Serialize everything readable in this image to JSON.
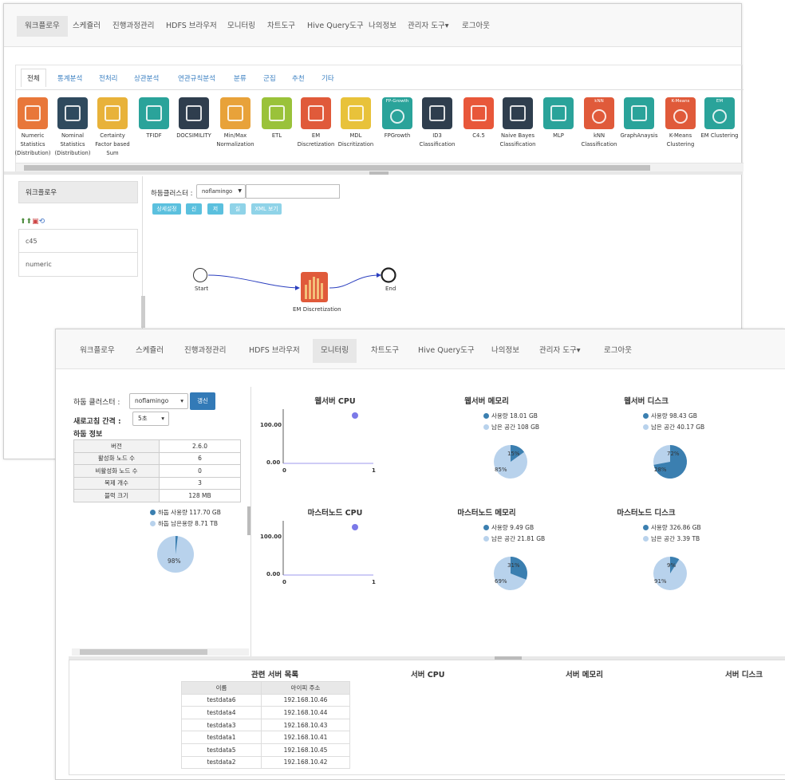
{
  "back_window": {
    "nav": [
      "워크플로우",
      "스케쥴러",
      "진행과정관리",
      "HDFS 브라우저",
      "모니터링",
      "차트도구",
      "Hive Query도구",
      "나의정보",
      "관리자 도구▾",
      "로그아웃"
    ],
    "tabs": [
      "전체",
      "통계분석",
      "전처리",
      "상관분석",
      "연관규칙분석",
      "분류",
      "군집",
      "추천",
      "기타"
    ],
    "tools": [
      {
        "label": "Numeric\nStatistics\n(Distribution)",
        "color": "#e8773a",
        "icon": "line-chart-icon"
      },
      {
        "label": "Nominal\nStatistics\n(Distribution)",
        "color": "#2f4a5e",
        "icon": "bar-chart-icon"
      },
      {
        "label": "Certainty\nFactor based\nSum",
        "color": "#e8b23a",
        "icon": "cf-sum-icon"
      },
      {
        "label": "TFIDF",
        "color": "#2aa39a",
        "icon": "scale-icon"
      },
      {
        "label": "DOCSIMILITY",
        "color": "#2f3e4e",
        "icon": "doc-similarity-icon"
      },
      {
        "label": "Min/Max\nNormalization",
        "color": "#e8a23a",
        "icon": "normalize-icon"
      },
      {
        "label": "ETL",
        "color": "#9ac23a",
        "icon": "etl-icon"
      },
      {
        "label": "EM\nDiscretization",
        "color": "#e05a3a",
        "icon": "em-discretization-icon"
      },
      {
        "label": "MDL\nDiscritization",
        "color": "#e8c23a",
        "icon": "mdl-icon"
      },
      {
        "label": "FPGrowth",
        "color": "#2aa39a",
        "icon": "fp-growth-icon",
        "badge": "FP-Growth"
      },
      {
        "label": "ID3\nClassification",
        "color": "#2f3e4e",
        "icon": "id3-icon"
      },
      {
        "label": "C4.5",
        "color": "#e8573a",
        "icon": "c45-icon"
      },
      {
        "label": "Naive Bayes\nClassification",
        "color": "#2f3e4e",
        "icon": "naive-bayes-icon"
      },
      {
        "label": "MLP",
        "color": "#2aa39a",
        "icon": "mlp-icon"
      },
      {
        "label": "kNN\nClassification",
        "color": "#e05a3a",
        "icon": "knn-icon",
        "badge": "kNN"
      },
      {
        "label": "GraphAnaysis",
        "color": "#2aa39a",
        "icon": "graph-icon"
      },
      {
        "label": "K-Means\nClustering",
        "color": "#e05a3a",
        "icon": "kmeans-icon",
        "badge": "K-Means"
      },
      {
        "label": "EM Clustering",
        "color": "#2aa39a",
        "icon": "em-clustering-icon",
        "badge": "EM"
      }
    ],
    "sidebar": {
      "title": "워크플로우",
      "items": [
        "c45",
        "numeric"
      ]
    },
    "cluster_label": "하둡클러스터 :",
    "cluster_value": "noflamingo",
    "buttons": [
      "상세설정",
      "신규",
      "저장",
      "실행",
      "XML 보기"
    ],
    "flow": {
      "start": "Start",
      "node": "EM Discretization",
      "end": "End"
    }
  },
  "front_window": {
    "nav": [
      "워크플로우",
      "스케쥴러",
      "진행과정관리",
      "HDFS 브라우저",
      "모니터링",
      "차트도구",
      "Hive Query도구",
      "나의정보",
      "관리자 도구▾",
      "로그아웃"
    ],
    "cluster_label": "하둡 클러스터 :",
    "cluster_value": "noflamingo",
    "refresh_button": "갱신",
    "interval_label": "새로고침 간격 :",
    "interval_value": "5초",
    "info_title": "하둡 정보",
    "info_rows": [
      [
        "버전",
        "2.6.0"
      ],
      [
        "활성화 노드 수",
        "6"
      ],
      [
        "비활성화 노드 수",
        "0"
      ],
      [
        "복제 개수",
        "3"
      ],
      [
        "블럭 크기",
        "128 MB"
      ]
    ],
    "hadoop_used": "하둡 사용량 117.70 GB",
    "hadoop_free": "하둡 남은용량 8.71 TB",
    "hadoop_pct": "98%",
    "colors": {
      "used": "#3b7fb0",
      "free": "#b8d2ec",
      "cpu_dot": "#7b79e8"
    },
    "panels": [
      {
        "title": "웹서버 CPU",
        "type": "cpu",
        "ymax": "100.00",
        "ymin": "0.00",
        "x0": "0",
        "x1": "1"
      },
      {
        "title": "웹서버 메모리",
        "type": "pie",
        "used": "사용량 18.01 GB",
        "free": "남은 공간 108 GB",
        "used_pct": "15%",
        "free_pct": "85%",
        "frac": 0.15
      },
      {
        "title": "웹서버 디스크",
        "type": "pie",
        "used": "사용량 98.43 GB",
        "free": "남은 공간 40.17 GB",
        "used_pct": "72%",
        "free_pct": "28%",
        "frac": 0.72
      },
      {
        "title": "마스터노드 CPU",
        "type": "cpu",
        "ymax": "100.00",
        "ymin": "0.00",
        "x0": "0",
        "x1": "1"
      },
      {
        "title": "마스터노드 메모리",
        "type": "pie",
        "used": "사용량 9.49 GB",
        "free": "남은 공간 21.81 GB",
        "used_pct": "31%",
        "free_pct": "69%",
        "frac": 0.31
      },
      {
        "title": "마스터노드 디스크",
        "type": "pie",
        "used": "사용량 326.86 GB",
        "free": "남은 공간 3.39 TB",
        "used_pct": "9%",
        "free_pct": "91%",
        "frac": 0.09
      }
    ],
    "server_list_title": "관련 서버 목록",
    "server_headers": [
      "이름",
      "아이피 주소"
    ],
    "servers": [
      [
        "testdata6",
        "192.168.10.46"
      ],
      [
        "testdata4",
        "192.168.10.44"
      ],
      [
        "testdata3",
        "192.168.10.43"
      ],
      [
        "testdata1",
        "192.168.10.41"
      ],
      [
        "testdata5",
        "192.168.10.45"
      ],
      [
        "testdata2",
        "192.168.10.42"
      ]
    ],
    "bottom_titles": [
      "서버 CPU",
      "서버 메모리",
      "서버 디스크"
    ]
  }
}
